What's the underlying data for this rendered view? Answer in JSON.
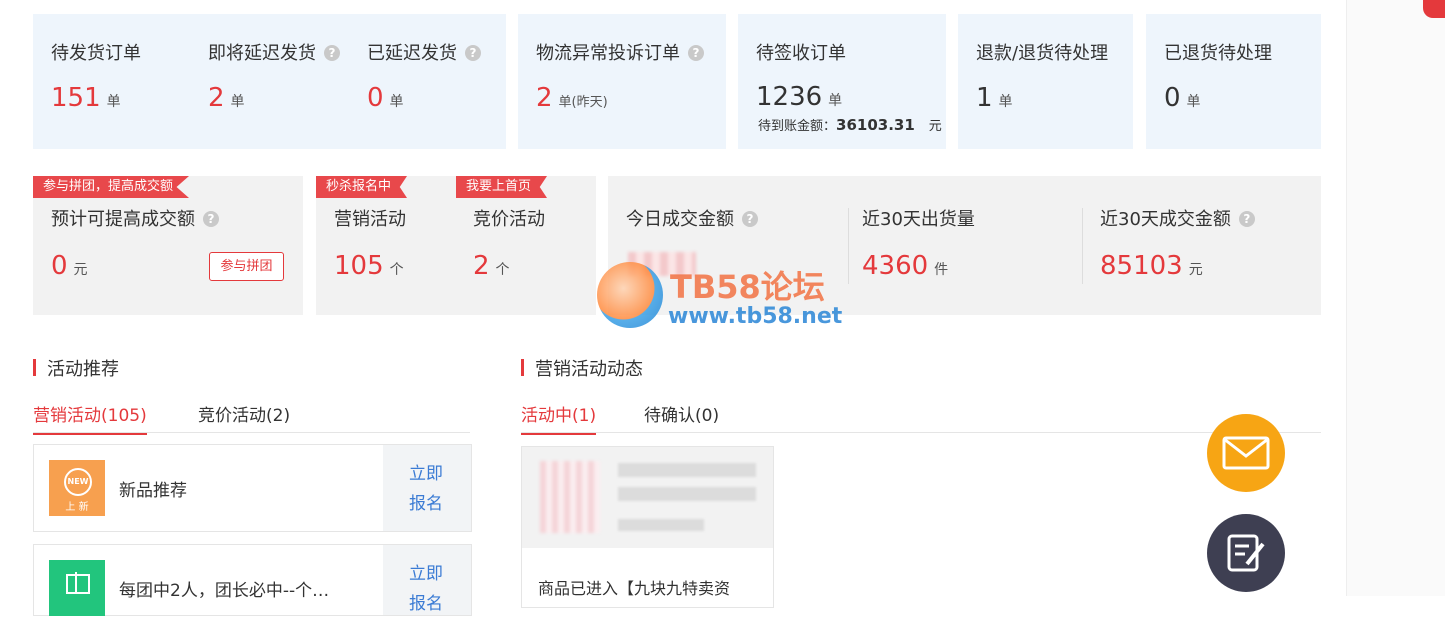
{
  "stats": {
    "pending_ship": {
      "label": "待发货订单",
      "value": "151",
      "unit": "单"
    },
    "soon_delay": {
      "label": "即将延迟发货",
      "value": "2",
      "unit": "单"
    },
    "delayed": {
      "label": "已延迟发货",
      "value": "0",
      "unit": "单"
    },
    "logistics": {
      "label": "物流异常投诉订单",
      "value": "2",
      "unit": "单(昨天)"
    },
    "to_sign": {
      "label": "待签收订单",
      "value": "1236",
      "unit": "单",
      "sub_label": "待到账金额：",
      "sub_value": "36103.31",
      "sub_unit": "元"
    },
    "refund": {
      "label": "退款/退货待处理",
      "value": "1",
      "unit": "单"
    },
    "returned": {
      "label": "已退货待处理",
      "value": "0",
      "unit": "单"
    }
  },
  "promo": {
    "pin": {
      "tag": "参与拼团，提高成交额",
      "label": "预计可提高成交额",
      "value": "0",
      "unit": "元",
      "button": "参与拼团"
    },
    "marketing": {
      "tag": "秒杀报名中",
      "label": "营销活动",
      "value": "105",
      "unit": "个"
    },
    "bidding": {
      "tag": "我要上首页",
      "label": "竞价活动",
      "value": "2",
      "unit": "个"
    },
    "today": {
      "label": "今日成交金额"
    },
    "ship30": {
      "label": "近30天出货量",
      "value": "4360",
      "unit": "件"
    },
    "gmv30": {
      "label": "近30天成交金额",
      "value": "85103",
      "unit": "元"
    }
  },
  "help_glyph": "?",
  "recommend": {
    "title": "活动推荐",
    "tabs": [
      "营销活动(105)",
      "竞价活动(2)"
    ],
    "items": [
      {
        "name": "新品推荐",
        "action": "立即报名",
        "icon_text": "NEW",
        "icon_sub": "上 新"
      },
      {
        "name": "每团中2人，团长必中--个…",
        "action": "立即报名"
      }
    ]
  },
  "dynamics": {
    "title": "营销活动动态",
    "tabs": [
      "活动中(1)",
      "待确认(0)"
    ],
    "card_text": "商品已进入【九块九特卖资"
  },
  "watermark": {
    "title": "TB58论坛",
    "url": "www.tb58.net"
  },
  "colors": {
    "accent": "#e4393c",
    "link": "#3b7bd4",
    "mail": "#f7a514",
    "edit": "#3e3f52"
  }
}
